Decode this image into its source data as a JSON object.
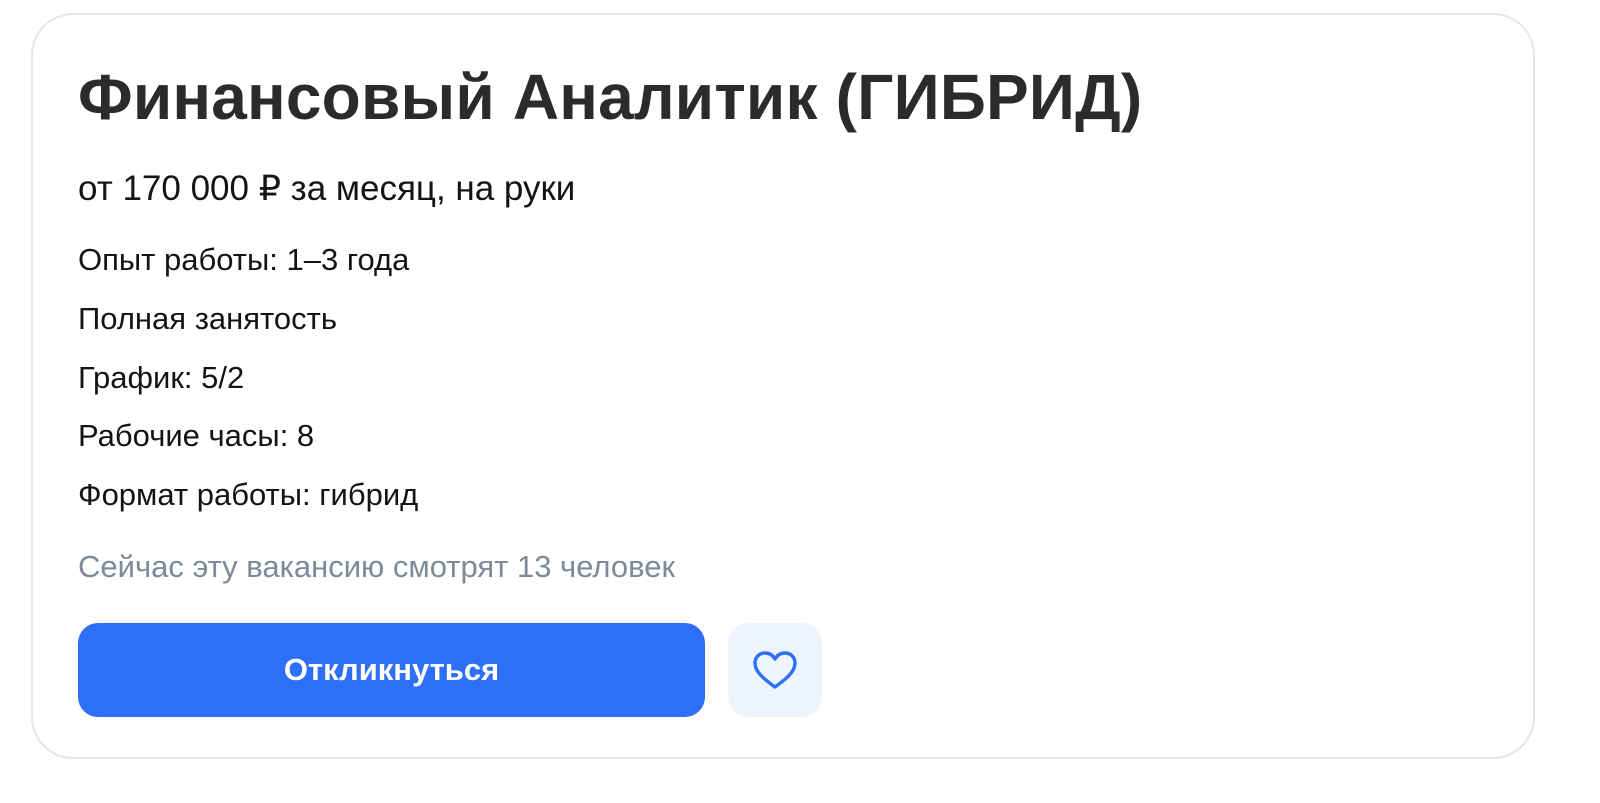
{
  "vacancy": {
    "title": "Финансовый Аналитик (ГИБРИД)",
    "salary": "от 170 000 ₽ за месяц, на руки",
    "details": [
      "Опыт работы: 1–3 года",
      "Полная занятость",
      "График: 5/2",
      "Рабочие часы: 8",
      "Формат работы: гибрид"
    ],
    "viewers": "Сейчас эту вакансию смотрят 13 человек"
  },
  "actions": {
    "respond_label": "Откликнуться",
    "favorite_icon": "heart-icon"
  },
  "colors": {
    "accent": "#2d6ff7",
    "favorite_bg": "#eef4fd",
    "muted_text": "#7d8a99",
    "title_text": "#2b2b2b"
  }
}
